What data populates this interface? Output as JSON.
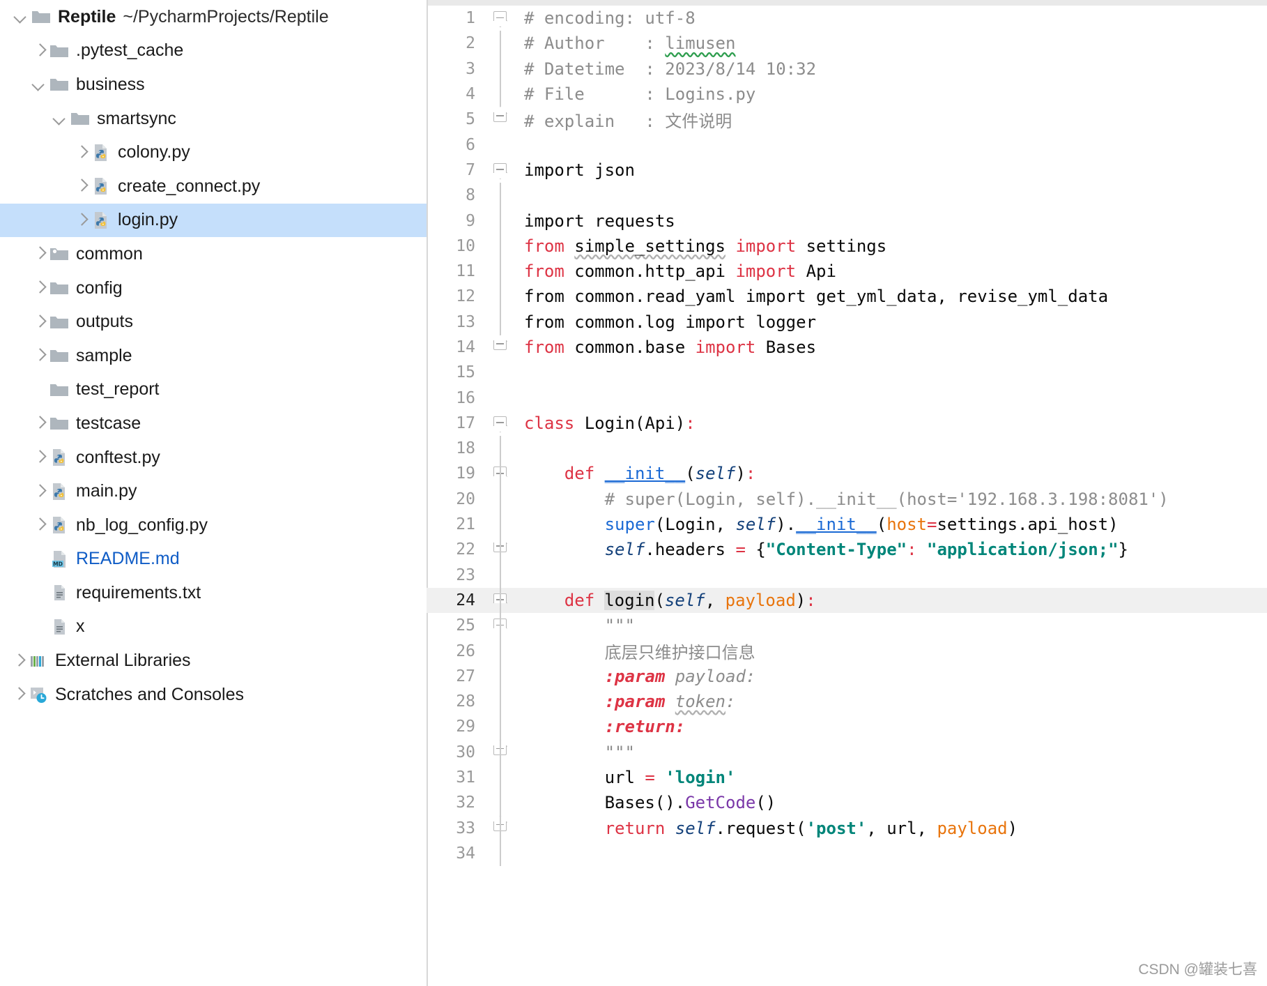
{
  "project": {
    "root_name": "Reptile",
    "root_path": "~/PycharmProjects/Reptile",
    "items": [
      {
        "label": ".pytest_cache",
        "icon": "folder-icon",
        "indent": 1,
        "arrow": "collapsed",
        "selected": false,
        "color": "default"
      },
      {
        "label": "business",
        "icon": "folder-icon",
        "indent": 1,
        "arrow": "expanded",
        "selected": false,
        "color": "default"
      },
      {
        "label": "smartsync",
        "icon": "folder-icon",
        "indent": 2,
        "arrow": "expanded",
        "selected": false,
        "color": "default"
      },
      {
        "label": "colony.py",
        "icon": "python-file-icon",
        "indent": 3,
        "arrow": "collapsed",
        "selected": false,
        "color": "default"
      },
      {
        "label": "create_connect.py",
        "icon": "python-file-icon",
        "indent": 3,
        "arrow": "collapsed",
        "selected": false,
        "color": "default"
      },
      {
        "label": "login.py",
        "icon": "python-file-icon",
        "indent": 3,
        "arrow": "collapsed",
        "selected": true,
        "color": "default"
      },
      {
        "label": "common",
        "icon": "source-folder-icon",
        "indent": 1,
        "arrow": "collapsed",
        "selected": false,
        "color": "default"
      },
      {
        "label": "config",
        "icon": "folder-icon",
        "indent": 1,
        "arrow": "collapsed",
        "selected": false,
        "color": "default"
      },
      {
        "label": "outputs",
        "icon": "folder-icon",
        "indent": 1,
        "arrow": "collapsed",
        "selected": false,
        "color": "default"
      },
      {
        "label": "sample",
        "icon": "folder-icon",
        "indent": 1,
        "arrow": "collapsed",
        "selected": false,
        "color": "default"
      },
      {
        "label": "test_report",
        "icon": "folder-icon",
        "indent": 1,
        "arrow": "none",
        "selected": false,
        "color": "default"
      },
      {
        "label": "testcase",
        "icon": "folder-icon",
        "indent": 1,
        "arrow": "collapsed",
        "selected": false,
        "color": "default"
      },
      {
        "label": "conftest.py",
        "icon": "python-file-icon",
        "indent": 1,
        "arrow": "collapsed",
        "selected": false,
        "color": "default"
      },
      {
        "label": "main.py",
        "icon": "python-file-icon",
        "indent": 1,
        "arrow": "collapsed",
        "selected": false,
        "color": "default"
      },
      {
        "label": "nb_log_config.py",
        "icon": "python-file-icon",
        "indent": 1,
        "arrow": "collapsed",
        "selected": false,
        "color": "default"
      },
      {
        "label": "README.md",
        "icon": "markdown-file-icon",
        "indent": 1,
        "arrow": "none",
        "selected": false,
        "color": "link"
      },
      {
        "label": "requirements.txt",
        "icon": "text-file-icon",
        "indent": 1,
        "arrow": "none",
        "selected": false,
        "color": "default"
      },
      {
        "label": "x",
        "icon": "text-file-icon",
        "indent": 1,
        "arrow": "none",
        "selected": false,
        "color": "default"
      },
      {
        "label": "External Libraries",
        "icon": "libraries-icon",
        "indent": 0,
        "arrow": "collapsed",
        "selected": false,
        "color": "default"
      },
      {
        "label": "Scratches and Consoles",
        "icon": "scratches-icon",
        "indent": 0,
        "arrow": "collapsed",
        "selected": false,
        "color": "default"
      }
    ]
  },
  "editor": {
    "file_name": "login.py",
    "current_line": 24,
    "lines": [
      {
        "n": 1,
        "fold": "start",
        "guide": false,
        "current": false,
        "tokens": [
          {
            "t": "# encoding: utf-8",
            "c": "k-comment"
          }
        ]
      },
      {
        "n": 2,
        "fold": "",
        "guide": true,
        "current": false,
        "tokens": [
          {
            "t": "# Author    : ",
            "c": "k-comment"
          },
          {
            "t": "limusen",
            "c": "k-comment squiggle-green"
          }
        ]
      },
      {
        "n": 3,
        "fold": "",
        "guide": true,
        "current": false,
        "tokens": [
          {
            "t": "# Datetime  : 2023/8/14 10:32",
            "c": "k-comment"
          }
        ]
      },
      {
        "n": 4,
        "fold": "",
        "guide": true,
        "current": false,
        "tokens": [
          {
            "t": "# File      : Logins.py",
            "c": "k-comment"
          }
        ]
      },
      {
        "n": 5,
        "fold": "end",
        "guide": false,
        "current": false,
        "tokens": [
          {
            "t": "# explain   : 文件说明",
            "c": "k-comment"
          }
        ]
      },
      {
        "n": 6,
        "fold": "",
        "guide": false,
        "current": false,
        "tokens": []
      },
      {
        "n": 7,
        "fold": "start",
        "guide": false,
        "current": false,
        "tokens": [
          {
            "t": "import json",
            "c": "k-plain"
          }
        ]
      },
      {
        "n": 8,
        "fold": "",
        "guide": true,
        "current": false,
        "tokens": []
      },
      {
        "n": 9,
        "fold": "",
        "guide": true,
        "current": false,
        "tokens": [
          {
            "t": "import requests",
            "c": "k-plain"
          }
        ]
      },
      {
        "n": 10,
        "fold": "",
        "guide": true,
        "current": false,
        "tokens": [
          {
            "t": "from",
            "c": "k-red"
          },
          {
            "t": " ",
            "c": "k-plain"
          },
          {
            "t": "simple_settings",
            "c": "k-plain squiggle-gray"
          },
          {
            "t": " ",
            "c": "k-plain"
          },
          {
            "t": "import",
            "c": "k-red"
          },
          {
            "t": " settings",
            "c": "k-plain"
          }
        ]
      },
      {
        "n": 11,
        "fold": "",
        "guide": true,
        "current": false,
        "tokens": [
          {
            "t": "from",
            "c": "k-red"
          },
          {
            "t": " common.http_api ",
            "c": "k-plain"
          },
          {
            "t": "import",
            "c": "k-red"
          },
          {
            "t": " Api",
            "c": "k-plain"
          }
        ]
      },
      {
        "n": 12,
        "fold": "",
        "guide": true,
        "current": false,
        "tokens": [
          {
            "t": "from common.read_yaml import get_yml_data, revise_yml_data",
            "c": "k-plain"
          }
        ]
      },
      {
        "n": 13,
        "fold": "",
        "guide": true,
        "current": false,
        "tokens": [
          {
            "t": "from common.log import logger",
            "c": "k-plain"
          }
        ]
      },
      {
        "n": 14,
        "fold": "end",
        "guide": false,
        "current": false,
        "tokens": [
          {
            "t": "from",
            "c": "k-red"
          },
          {
            "t": " common.base ",
            "c": "k-plain"
          },
          {
            "t": "import",
            "c": "k-red"
          },
          {
            "t": " Bases",
            "c": "k-plain"
          }
        ]
      },
      {
        "n": 15,
        "fold": "",
        "guide": false,
        "current": false,
        "tokens": []
      },
      {
        "n": 16,
        "fold": "",
        "guide": false,
        "current": false,
        "tokens": []
      },
      {
        "n": 17,
        "fold": "start",
        "guide": false,
        "current": false,
        "tokens": [
          {
            "t": "class",
            "c": "k-red"
          },
          {
            "t": " Login(Api)",
            "c": "k-plain"
          },
          {
            "t": ":",
            "c": "k-op"
          }
        ]
      },
      {
        "n": 18,
        "fold": "",
        "guide": true,
        "current": false,
        "tokens": []
      },
      {
        "n": 19,
        "fold": "start",
        "guide": true,
        "current": false,
        "tokens": [
          {
            "t": "    ",
            "c": "k-plain"
          },
          {
            "t": "def",
            "c": "k-red"
          },
          {
            "t": " ",
            "c": "k-plain"
          },
          {
            "t": "__init__",
            "c": "k-blue-u"
          },
          {
            "t": "(",
            "c": "k-plain"
          },
          {
            "t": "self",
            "c": "k-self"
          },
          {
            "t": ")",
            "c": "k-plain"
          },
          {
            "t": ":",
            "c": "k-op"
          }
        ]
      },
      {
        "n": 20,
        "fold": "",
        "guide": true,
        "current": false,
        "tokens": [
          {
            "t": "        # super(Login, self).__init__(host='192.168.3.198:8081')",
            "c": "k-comment"
          }
        ]
      },
      {
        "n": 21,
        "fold": "",
        "guide": true,
        "current": false,
        "tokens": [
          {
            "t": "        ",
            "c": "k-plain"
          },
          {
            "t": "super",
            "c": "k-blue"
          },
          {
            "t": "(Login, ",
            "c": "k-plain"
          },
          {
            "t": "self",
            "c": "k-self"
          },
          {
            "t": ").",
            "c": "k-plain"
          },
          {
            "t": "__init__",
            "c": "k-blue-u"
          },
          {
            "t": "(",
            "c": "k-plain"
          },
          {
            "t": "host",
            "c": "k-param"
          },
          {
            "t": "=",
            "c": "k-op"
          },
          {
            "t": "settings.api_host)",
            "c": "k-plain"
          }
        ]
      },
      {
        "n": 22,
        "fold": "end",
        "guide": true,
        "current": false,
        "tokens": [
          {
            "t": "        ",
            "c": "k-plain"
          },
          {
            "t": "self",
            "c": "k-self"
          },
          {
            "t": ".headers ",
            "c": "k-plain"
          },
          {
            "t": "=",
            "c": "k-op"
          },
          {
            "t": " {",
            "c": "k-plain"
          },
          {
            "t": "\"Content-Type\"",
            "c": "k-str"
          },
          {
            "t": ":",
            "c": "k-op"
          },
          {
            "t": " ",
            "c": "k-plain"
          },
          {
            "t": "\"application/json;\"",
            "c": "k-str"
          },
          {
            "t": "}",
            "c": "k-plain"
          }
        ]
      },
      {
        "n": 23,
        "fold": "",
        "guide": true,
        "current": false,
        "tokens": []
      },
      {
        "n": 24,
        "fold": "start",
        "guide": true,
        "current": true,
        "tokens": [
          {
            "t": "    ",
            "c": "k-plain"
          },
          {
            "t": "def",
            "c": "k-red"
          },
          {
            "t": " ",
            "c": "k-plain"
          },
          {
            "t": "login",
            "c": "k-plain ident-hl",
            "caret": true
          },
          {
            "t": "(",
            "c": "k-plain"
          },
          {
            "t": "self",
            "c": "k-self"
          },
          {
            "t": ", ",
            "c": "k-plain"
          },
          {
            "t": "payload",
            "c": "k-param"
          },
          {
            "t": ")",
            "c": "k-plain"
          },
          {
            "t": ":",
            "c": "k-op"
          }
        ]
      },
      {
        "n": 25,
        "fold": "start",
        "guide": true,
        "current": false,
        "tokens": [
          {
            "t": "        \"\"\"",
            "c": "k-doc"
          }
        ]
      },
      {
        "n": 26,
        "fold": "",
        "guide": true,
        "current": false,
        "tokens": [
          {
            "t": "        底层只维护接口信息",
            "c": "k-doc"
          }
        ]
      },
      {
        "n": 27,
        "fold": "",
        "guide": true,
        "current": false,
        "tokens": [
          {
            "t": "        ",
            "c": "k-doc"
          },
          {
            "t": ":param",
            "c": "k-doctag"
          },
          {
            "t": " payload:",
            "c": "k-docarg"
          }
        ]
      },
      {
        "n": 28,
        "fold": "",
        "guide": true,
        "current": false,
        "tokens": [
          {
            "t": "        ",
            "c": "k-doc"
          },
          {
            "t": ":param",
            "c": "k-doctag"
          },
          {
            "t": " ",
            "c": "k-docarg"
          },
          {
            "t": "token",
            "c": "k-docarg squiggle-gray"
          },
          {
            "t": ":",
            "c": "k-docarg"
          }
        ]
      },
      {
        "n": 29,
        "fold": "",
        "guide": true,
        "current": false,
        "tokens": [
          {
            "t": "        ",
            "c": "k-doc"
          },
          {
            "t": ":return:",
            "c": "k-doctag"
          }
        ]
      },
      {
        "n": 30,
        "fold": "end",
        "guide": true,
        "current": false,
        "tokens": [
          {
            "t": "        \"\"\"",
            "c": "k-doc"
          }
        ]
      },
      {
        "n": 31,
        "fold": "",
        "guide": true,
        "current": false,
        "tokens": [
          {
            "t": "        url ",
            "c": "k-plain"
          },
          {
            "t": "=",
            "c": "k-op"
          },
          {
            "t": " ",
            "c": "k-plain"
          },
          {
            "t": "'login'",
            "c": "k-str"
          }
        ]
      },
      {
        "n": 32,
        "fold": "",
        "guide": true,
        "current": false,
        "tokens": [
          {
            "t": "        ",
            "c": "k-plain"
          },
          {
            "t": "Bases",
            "c": "k-plain"
          },
          {
            "t": "().",
            "c": "k-plain"
          },
          {
            "t": "GetCode",
            "c": "k-purple"
          },
          {
            "t": "()",
            "c": "k-plain"
          }
        ]
      },
      {
        "n": 33,
        "fold": "end",
        "guide": true,
        "current": false,
        "tokens": [
          {
            "t": "        ",
            "c": "k-plain"
          },
          {
            "t": "return",
            "c": "k-red"
          },
          {
            "t": " ",
            "c": "k-plain"
          },
          {
            "t": "self",
            "c": "k-self"
          },
          {
            "t": ".request(",
            "c": "k-plain"
          },
          {
            "t": "'post'",
            "c": "k-str"
          },
          {
            "t": ", url, ",
            "c": "k-plain"
          },
          {
            "t": "payload",
            "c": "k-param"
          },
          {
            "t": ")",
            "c": "k-plain"
          }
        ]
      },
      {
        "n": 34,
        "fold": "",
        "guide": true,
        "current": false,
        "tokens": []
      }
    ]
  },
  "watermark": "CSDN @罐装七喜",
  "colors": {
    "selection": "#c5dffb",
    "current_line": "#f0f0f0",
    "keyword": "#dd3344",
    "string": "#008579",
    "param": "#e8740c",
    "builtin": "#1a69d4",
    "comment": "#8c8c8c",
    "link": "#0f5cc6"
  }
}
